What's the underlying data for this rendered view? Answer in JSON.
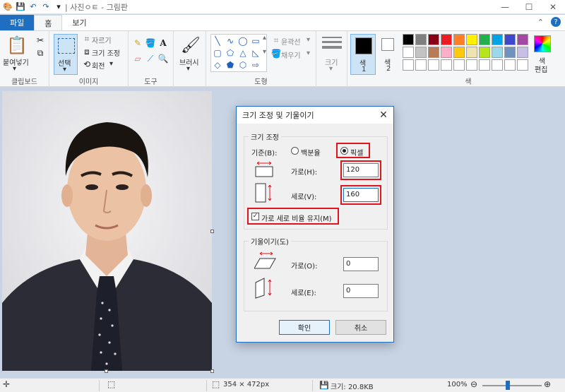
{
  "window": {
    "title": "| 사진ㅇㅌ - 그림판",
    "minimize": "—",
    "maximize": "☐",
    "close": "✕"
  },
  "tabs": {
    "file": "파일",
    "home": "홈",
    "view": "보기"
  },
  "ribbon": {
    "clipboard": {
      "label": "클립보드",
      "paste": "붙여넣기"
    },
    "image": {
      "label": "이미지",
      "select": "선택",
      "crop": "자르기",
      "resize": "크기 조정",
      "rotate": "회전"
    },
    "tools": {
      "label": "도구"
    },
    "brushes": {
      "label": "브러시"
    },
    "shapes": {
      "label": "도형",
      "outline": "윤곽선",
      "fill": "채우기"
    },
    "size": {
      "label": "크기"
    },
    "color1": {
      "label": "색",
      "num": "1",
      "hex": "#000000"
    },
    "color2": {
      "label": "색",
      "num": "2",
      "hex": "#ffffff"
    },
    "colors": {
      "label": "색",
      "edit_line1": "색",
      "edit_line2": "편집"
    },
    "palette_row1": [
      "#000000",
      "#7f7f7f",
      "#880015",
      "#ed1c24",
      "#ff7f27",
      "#fff200",
      "#22b14c",
      "#00a2e8",
      "#3f48cc",
      "#a349a4"
    ],
    "palette_row2": [
      "#ffffff",
      "#c3c3c3",
      "#b97a57",
      "#ffaec9",
      "#ffc90e",
      "#efe4b0",
      "#b5e61d",
      "#99d9ea",
      "#7092be",
      "#c8bfe7"
    ]
  },
  "dialog": {
    "title": "크기 조정 및 기울이기",
    "resize_group": "크기 조정",
    "basis_label": "기준(B):",
    "percent": "백분율",
    "pixels": "픽셀",
    "horizontal_label": "가로(H):",
    "horizontal_value": "120",
    "vertical_label": "세로(V):",
    "vertical_value": "160",
    "keep_ratio": "가로 세로 비율 유지(M)",
    "skew_group": "기울이기(도)",
    "skew_h_label": "가로(O):",
    "skew_h_value": "0",
    "skew_v_label": "세로(E):",
    "skew_v_value": "0",
    "ok": "확인",
    "cancel": "취소"
  },
  "status": {
    "dimensions": "354 × 472px",
    "filesize": "크기: 20.8KB",
    "zoom": "100%",
    "zoom_level": 0.43
  }
}
